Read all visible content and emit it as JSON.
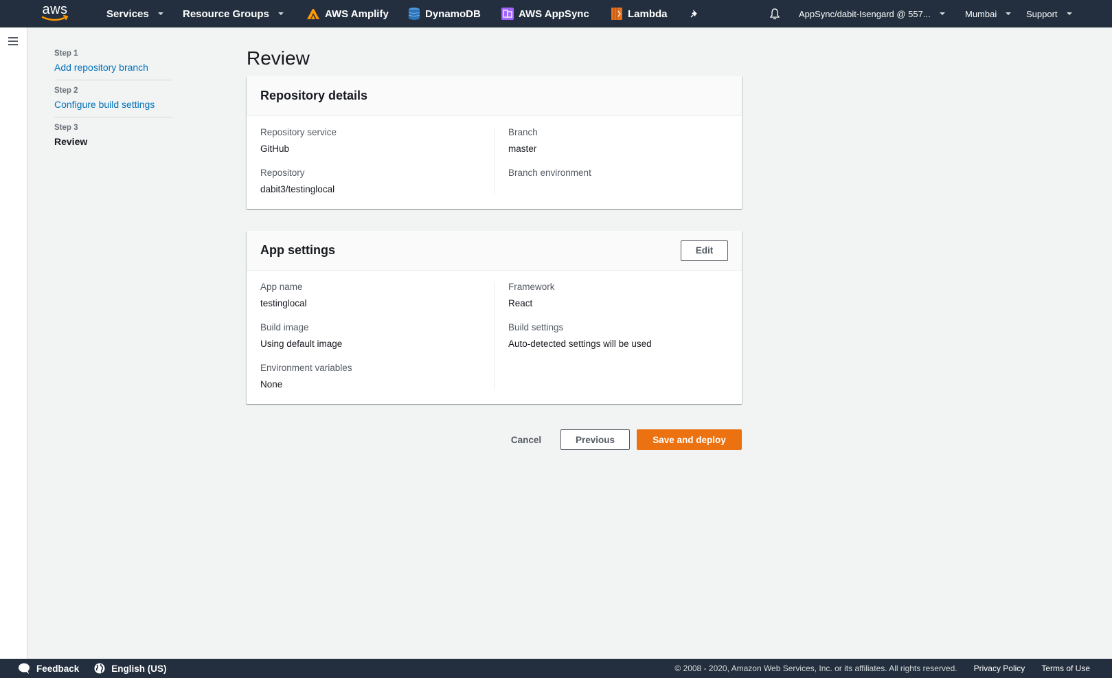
{
  "topnav": {
    "logo_text": "aws",
    "services_label": "Services",
    "resource_groups_label": "Resource Groups",
    "shortcuts": [
      {
        "label": "AWS Amplify",
        "icon": "amplify-icon",
        "color": "#ff9900"
      },
      {
        "label": "DynamoDB",
        "icon": "dynamodb-icon",
        "color": "#2e73b8"
      },
      {
        "label": "AWS AppSync",
        "icon": "appsync-icon",
        "color": "#a166ff"
      },
      {
        "label": "Lambda",
        "icon": "lambda-icon",
        "color": "#e7701e"
      }
    ],
    "pin_icon": "pin-icon",
    "bell_icon": "bell-icon",
    "account_label": "AppSync/dabit-Isengard @ 557...",
    "region_label": "Mumbai",
    "support_label": "Support"
  },
  "wizard": {
    "steps": [
      {
        "number": "Step 1",
        "label": "Add repository branch",
        "state": "link"
      },
      {
        "number": "Step 2",
        "label": "Configure build settings",
        "state": "link"
      },
      {
        "number": "Step 3",
        "label": "Review",
        "state": "current"
      }
    ]
  },
  "main": {
    "title": "Review",
    "repository_details": {
      "title": "Repository details",
      "left": [
        {
          "label": "Repository service",
          "value": "GitHub"
        },
        {
          "label": "Repository",
          "value": "dabit3/testinglocal"
        }
      ],
      "right": [
        {
          "label": "Branch",
          "value": "master"
        },
        {
          "label": "Branch environment",
          "value": ""
        }
      ]
    },
    "app_settings": {
      "title": "App settings",
      "edit_label": "Edit",
      "left": [
        {
          "label": "App name",
          "value": "testinglocal"
        },
        {
          "label": "Build image",
          "value": "Using default image"
        },
        {
          "label": "Environment variables",
          "value": "None"
        }
      ],
      "right": [
        {
          "label": "Framework",
          "value": "React"
        },
        {
          "label": "Build settings",
          "value": "Auto-detected settings will be used"
        }
      ]
    },
    "actions": {
      "cancel_label": "Cancel",
      "previous_label": "Previous",
      "save_label": "Save and deploy"
    }
  },
  "footer": {
    "feedback_label": "Feedback",
    "language_label": "English (US)",
    "copyright": "© 2008 - 2020, Amazon Web Services, Inc. or its affiliates. All rights reserved.",
    "privacy_label": "Privacy Policy",
    "terms_label": "Terms of Use"
  },
  "colors": {
    "nav_bg": "#232f3e",
    "link": "#0073bb",
    "primary": "#ec7211",
    "page_bg": "#f2f3f3"
  }
}
